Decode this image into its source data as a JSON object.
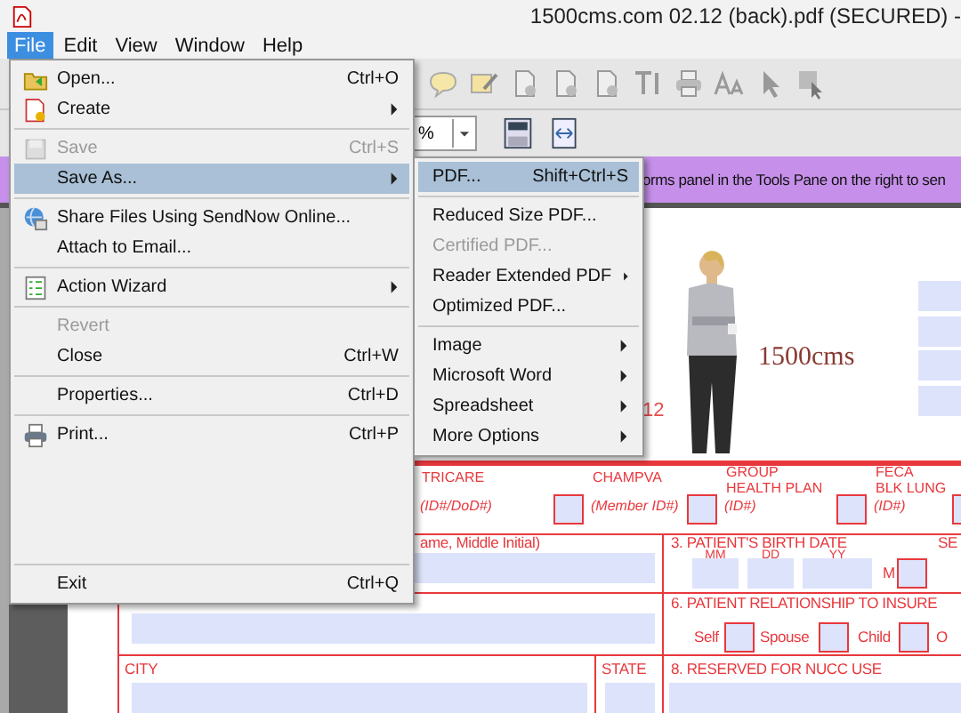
{
  "window": {
    "title": "1500cms.com 02.12 (back).pdf (SECURED) -"
  },
  "menu_bar": [
    {
      "label": "File",
      "selected": true
    },
    {
      "label": "Edit",
      "selected": false
    },
    {
      "label": "View",
      "selected": false
    },
    {
      "label": "Window",
      "selected": false
    },
    {
      "label": "Help",
      "selected": false
    }
  ],
  "toolbar": {
    "zoom_field": {
      "value": "%"
    }
  },
  "banner": {
    "text": "orms panel in the Tools Pane on the right to sen"
  },
  "file_menu": {
    "groups": [
      [
        {
          "label": "Open...",
          "shortcut": "Ctrl+O",
          "disabled": false,
          "selected": false,
          "has_submenu": false
        },
        {
          "label": "Create",
          "disabled": false,
          "selected": false,
          "has_submenu": true
        }
      ],
      [
        {
          "label": "Save",
          "shortcut": "Ctrl+S",
          "disabled": true,
          "selected": false,
          "has_submenu": false
        },
        {
          "label": "Save As...",
          "disabled": false,
          "selected": true,
          "has_submenu": true
        }
      ],
      [
        {
          "label": "Share Files Using SendNow Online...",
          "disabled": false,
          "selected": false,
          "has_submenu": false
        },
        {
          "label": "Attach to Email...",
          "disabled": false,
          "selected": false,
          "has_submenu": false
        }
      ],
      [
        {
          "label": "Action Wizard",
          "disabled": false,
          "selected": false,
          "has_submenu": true
        }
      ],
      [
        {
          "label": "Revert",
          "disabled": true,
          "selected": false,
          "has_submenu": false
        },
        {
          "label": "Close",
          "shortcut": "Ctrl+W",
          "disabled": false,
          "selected": false,
          "has_submenu": false
        }
      ],
      [
        {
          "label": "Properties...",
          "shortcut": "Ctrl+D",
          "disabled": false,
          "selected": false,
          "has_submenu": false
        }
      ],
      [
        {
          "label": "Print...",
          "shortcut": "Ctrl+P",
          "disabled": false,
          "selected": false,
          "has_submenu": false
        }
      ],
      [
        {
          "label": "Exit",
          "shortcut": "Ctrl+Q",
          "disabled": false,
          "selected": false,
          "has_submenu": false
        }
      ]
    ]
  },
  "save_as_menu": {
    "groups": [
      [
        {
          "label": "PDF...",
          "shortcut": "Shift+Ctrl+S",
          "disabled": false,
          "selected": true,
          "has_submenu": false
        }
      ],
      [
        {
          "label": "Reduced Size PDF...",
          "disabled": false,
          "selected": false,
          "has_submenu": false
        },
        {
          "label": "Certified PDF...",
          "disabled": true,
          "selected": false,
          "has_submenu": false
        },
        {
          "label": "Reader Extended PDF",
          "disabled": false,
          "selected": false,
          "has_submenu": true
        },
        {
          "label": "Optimized PDF...",
          "disabled": false,
          "selected": false,
          "has_submenu": false
        }
      ],
      [
        {
          "label": "Image",
          "disabled": false,
          "selected": false,
          "has_submenu": true
        },
        {
          "label": "Microsoft Word",
          "disabled": false,
          "selected": false,
          "has_submenu": true
        },
        {
          "label": "Spreadsheet",
          "disabled": false,
          "selected": false,
          "has_submenu": true
        },
        {
          "label": "More Options",
          "disabled": false,
          "selected": false,
          "has_submenu": true
        }
      ]
    ]
  },
  "document": {
    "logo_text": "1500cms",
    "page_fragment": "12",
    "coverage_types": [
      {
        "label": "TRICARE",
        "id_hint": "(ID#/DoD#)",
        "checked": false
      },
      {
        "label": "CHAMPVA",
        "id_hint": "(Member ID#)",
        "checked": false
      },
      {
        "label": "GROUP\nHEALTH PLAN",
        "id_hint": "(ID#)",
        "checked": false
      },
      {
        "label": "FECA\nBLK LUNG",
        "id_hint": "(ID#)",
        "checked": false
      }
    ],
    "name_label": "ame, Middle Initial)",
    "birth_date": {
      "label": "3. PATIENT'S BIRTH DATE",
      "parts": [
        "MM",
        "DD",
        "YY"
      ],
      "sex_label": "SE",
      "sex_option": {
        "label": "M",
        "checked": false
      }
    },
    "relationship": {
      "label": "6. PATIENT RELATIONSHIP TO INSURE",
      "options": [
        {
          "label": "Self",
          "checked": false
        },
        {
          "label": "Spouse",
          "checked": false
        },
        {
          "label": "Child",
          "checked": false
        },
        {
          "label": "O"
        }
      ]
    },
    "city_label": "CITY",
    "state_label": "STATE",
    "reserved_label": "8. RESERVED FOR NUCC USE"
  }
}
